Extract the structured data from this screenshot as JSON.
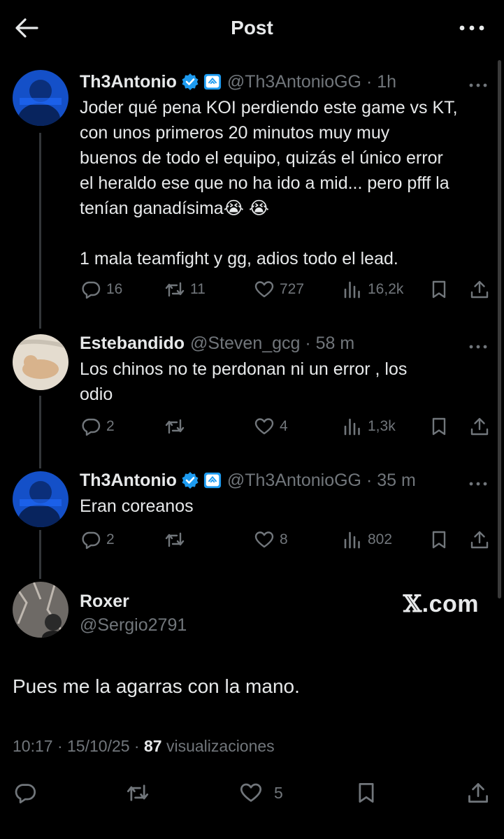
{
  "header": {
    "title": "Post"
  },
  "tweets": [
    {
      "name": "Th3Antonio",
      "handle": "@Th3AntonioGG",
      "time": "1h",
      "text": "Joder qué pena KOI perdiendo este game vs KT,\ncon unos primeros 20 minutos muy muy\nbuenos de todo el equipo, quizás el único error\nel heraldo ese que no ha ido a mid... pero pfff la\ntenían ganadísima😭 😭\n\n1 mala teamfight y gg, adios todo el lead.",
      "replies": "16",
      "reposts": "11",
      "likes": "727",
      "views": "16,2k"
    },
    {
      "name": "Estebandido",
      "handle": "@Steven_gcg",
      "time": "58 m",
      "text": "Los chinos no te perdonan ni un error , los\nodio",
      "replies": "2",
      "reposts": "",
      "likes": "4",
      "views": "1,3k"
    },
    {
      "name": "Th3Antonio",
      "handle": "@Th3AntonioGG",
      "time": "35 m",
      "text": "Eran coreanos",
      "replies": "2",
      "reposts": "",
      "likes": "8",
      "views": "802"
    }
  ],
  "main": {
    "name": "Roxer",
    "handle": "@Sergio2791",
    "watermark_mark": "𝕏",
    "watermark_text": ".com",
    "text": "Pues me la agarras con la mano.",
    "time": "10:17",
    "date": "15/10/25",
    "views_count": "87",
    "views_label": "visualizaciones",
    "likes": "5"
  },
  "colors": {
    "background": "#000000",
    "text": "#e7e9ea",
    "muted": "#71767b",
    "verified": "#1d9bf0"
  },
  "icons": [
    "back-arrow-icon",
    "more-icon",
    "verified-icon",
    "affiliate-badge-icon",
    "reply-icon",
    "repost-icon",
    "like-icon",
    "views-icon",
    "bookmark-icon",
    "share-icon"
  ]
}
